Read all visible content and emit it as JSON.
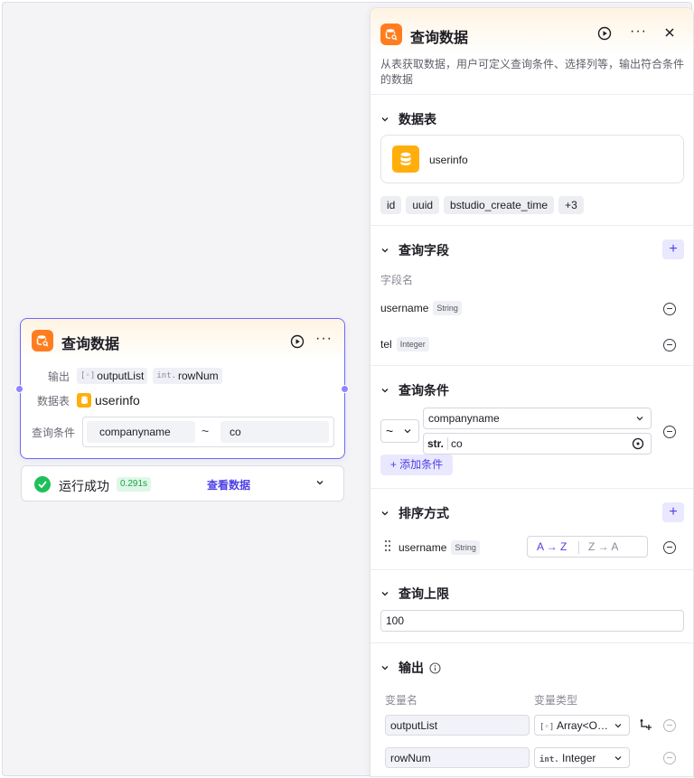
{
  "node": {
    "title": "查询数据",
    "output_label": "输出",
    "outputs": [
      {
        "type": "[◦]",
        "name": "outputList"
      },
      {
        "type": "int.",
        "name": "rowNum"
      }
    ],
    "table_label": "数据表",
    "table_name": "userinfo",
    "condition_label": "查询条件",
    "condition": {
      "field": "companyname",
      "operator": "~",
      "value": "co"
    }
  },
  "status": {
    "text": "运行成功",
    "time": "0.291s",
    "view_link": "查看数据"
  },
  "panel": {
    "title": "查询数据",
    "description": "从表获取数据，用户可定义查询条件、选择列等，输出符合条件的数据",
    "table_section": {
      "title": "数据表",
      "table_name": "userinfo",
      "columns": [
        "id",
        "uuid",
        "bstudio_create_time",
        "+3"
      ]
    },
    "fields_section": {
      "title": "查询字段",
      "add_label": "+",
      "column_header": "字段名",
      "fields": [
        {
          "name": "username",
          "type": "String"
        },
        {
          "name": "tel",
          "type": "Integer"
        }
      ]
    },
    "conditions_section": {
      "title": "查询条件",
      "operator": "~",
      "field": "companyname",
      "value_type": "str.",
      "value": "co",
      "add_condition": "+ 添加条件"
    },
    "sort_section": {
      "title": "排序方式",
      "add_label": "+",
      "field": "username",
      "field_type": "String",
      "asc_label": "A → Z",
      "desc_label": "Z → A"
    },
    "limit_section": {
      "title": "查询上限",
      "value": "100"
    },
    "output_section": {
      "title": "输出",
      "var_name_header": "变量名",
      "var_type_header": "变量类型",
      "rows": [
        {
          "name": "outputList",
          "type_icon": "[◦]",
          "type": "Array<O…"
        },
        {
          "name": "rowNum",
          "type_icon": "int.",
          "type": "Integer"
        }
      ]
    }
  },
  "colors": {
    "accent": "#4e40e5",
    "node_icon": "#ff7d1f",
    "table_icon": "#ffae0b",
    "success": "#1fbf5a"
  }
}
